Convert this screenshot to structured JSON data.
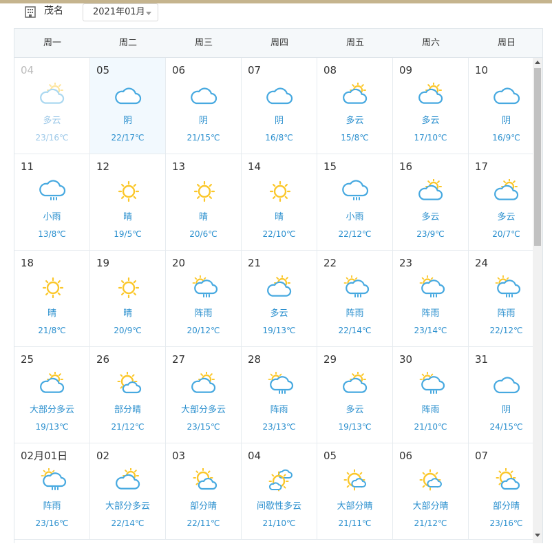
{
  "header": {
    "city": "茂名",
    "month": "2021年01月",
    "city_icon": "building-icon",
    "dropdown_icon": "chevron-down-icon"
  },
  "weekdays": [
    "周一",
    "周二",
    "周三",
    "周四",
    "周五",
    "周六",
    "周日"
  ],
  "days": [
    {
      "date": "04",
      "desc": "多云",
      "temp": "23/16℃",
      "icon": "partly-cloudy",
      "past": true
    },
    {
      "date": "05",
      "desc": "阴",
      "temp": "22/17℃",
      "icon": "cloudy",
      "today": true
    },
    {
      "date": "06",
      "desc": "阴",
      "temp": "21/15℃",
      "icon": "cloudy"
    },
    {
      "date": "07",
      "desc": "阴",
      "temp": "16/8℃",
      "icon": "cloudy"
    },
    {
      "date": "08",
      "desc": "多云",
      "temp": "15/8℃",
      "icon": "partly-cloudy"
    },
    {
      "date": "09",
      "desc": "多云",
      "temp": "17/10℃",
      "icon": "partly-cloudy"
    },
    {
      "date": "10",
      "desc": "阴",
      "temp": "16/9℃",
      "icon": "cloudy"
    },
    {
      "date": "11",
      "desc": "小雨",
      "temp": "13/8℃",
      "icon": "rain"
    },
    {
      "date": "12",
      "desc": "晴",
      "temp": "19/5℃",
      "icon": "sunny"
    },
    {
      "date": "13",
      "desc": "晴",
      "temp": "20/6℃",
      "icon": "sunny"
    },
    {
      "date": "14",
      "desc": "晴",
      "temp": "22/10℃",
      "icon": "sunny"
    },
    {
      "date": "15",
      "desc": "小雨",
      "temp": "22/12℃",
      "icon": "rain"
    },
    {
      "date": "16",
      "desc": "多云",
      "temp": "23/9℃",
      "icon": "partly-cloudy"
    },
    {
      "date": "17",
      "desc": "多云",
      "temp": "20/7℃",
      "icon": "partly-cloudy"
    },
    {
      "date": "18",
      "desc": "晴",
      "temp": "21/8℃",
      "icon": "sunny"
    },
    {
      "date": "19",
      "desc": "晴",
      "temp": "20/9℃",
      "icon": "sunny"
    },
    {
      "date": "20",
      "desc": "阵雨",
      "temp": "20/12℃",
      "icon": "shower"
    },
    {
      "date": "21",
      "desc": "多云",
      "temp": "19/13℃",
      "icon": "partly-cloudy"
    },
    {
      "date": "22",
      "desc": "阵雨",
      "temp": "22/14℃",
      "icon": "shower"
    },
    {
      "date": "23",
      "desc": "阵雨",
      "temp": "23/14℃",
      "icon": "shower"
    },
    {
      "date": "24",
      "desc": "阵雨",
      "temp": "22/12℃",
      "icon": "shower"
    },
    {
      "date": "25",
      "desc": "大部分多云",
      "temp": "19/13℃",
      "icon": "partly-cloudy"
    },
    {
      "date": "26",
      "desc": "部分晴",
      "temp": "21/12℃",
      "icon": "partly-sunny"
    },
    {
      "date": "27",
      "desc": "大部分多云",
      "temp": "23/15℃",
      "icon": "partly-cloudy"
    },
    {
      "date": "28",
      "desc": "阵雨",
      "temp": "23/13℃",
      "icon": "shower"
    },
    {
      "date": "29",
      "desc": "多云",
      "temp": "19/13℃",
      "icon": "partly-cloudy"
    },
    {
      "date": "30",
      "desc": "阵雨",
      "temp": "21/10℃",
      "icon": "shower"
    },
    {
      "date": "31",
      "desc": "阴",
      "temp": "24/15℃",
      "icon": "cloudy"
    },
    {
      "date": "02月01日",
      "desc": "阵雨",
      "temp": "23/16℃",
      "icon": "shower"
    },
    {
      "date": "02",
      "desc": "大部分多云",
      "temp": "22/14℃",
      "icon": "partly-cloudy"
    },
    {
      "date": "03",
      "desc": "部分晴",
      "temp": "22/11℃",
      "icon": "partly-sunny"
    },
    {
      "date": "04",
      "desc": "间歇性多云",
      "temp": "21/10℃",
      "icon": "intermittent-cloudy"
    },
    {
      "date": "05",
      "desc": "大部分晴",
      "temp": "21/11℃",
      "icon": "mostly-sunny"
    },
    {
      "date": "06",
      "desc": "大部分晴",
      "temp": "21/12℃",
      "icon": "mostly-sunny"
    },
    {
      "date": "07",
      "desc": "部分晴",
      "temp": "23/16℃",
      "icon": "partly-sunny"
    }
  ],
  "colors": {
    "sun": "#fbc72a",
    "cloud": "#47a9e0",
    "text": "#2a8fce",
    "today_bg": "#f2f9fe"
  }
}
